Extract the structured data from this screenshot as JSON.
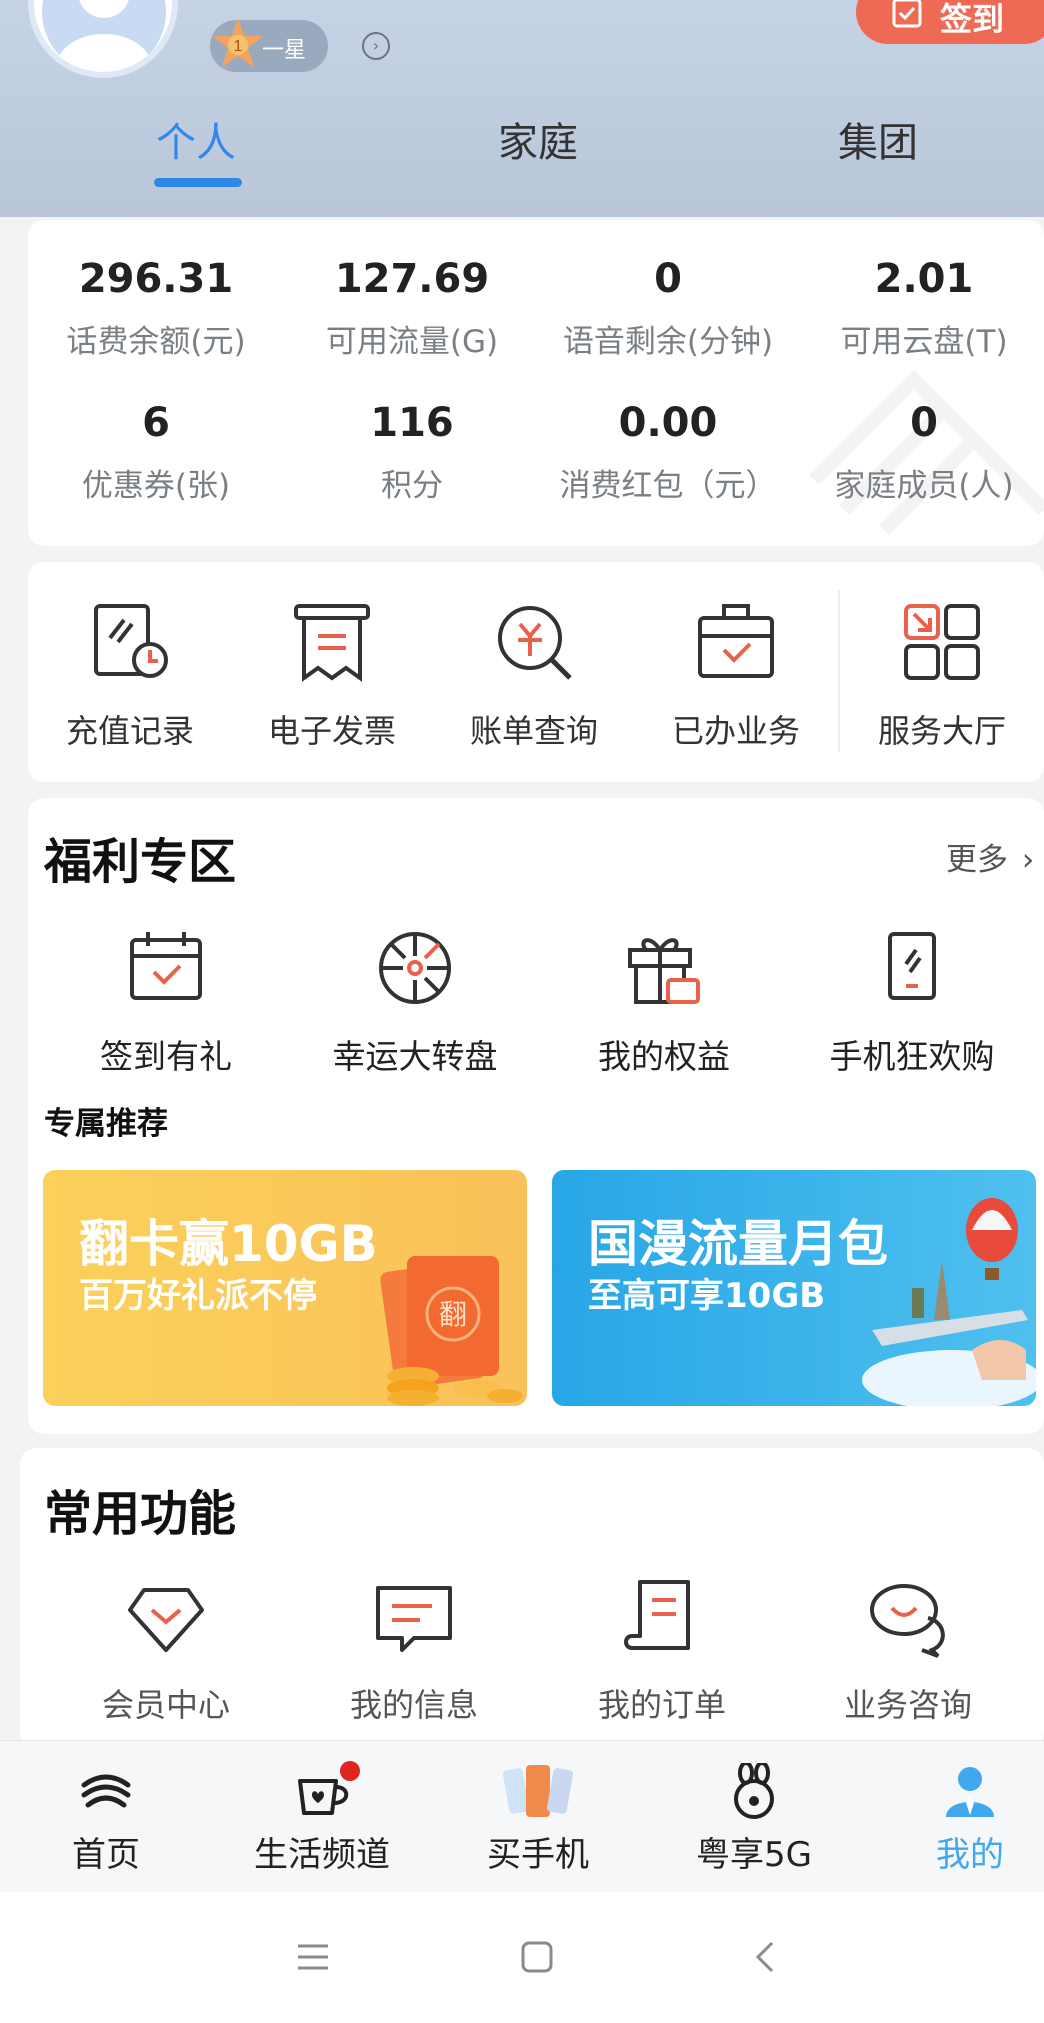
{
  "colors": {
    "accent_blue": "#2f88e8",
    "signin_orange": "#ef6a55",
    "icon_red": "#e9614a",
    "nav_active": "#41a7ee"
  },
  "header": {
    "level_badge": "1",
    "level_text": "一星",
    "signin_label": "签到",
    "tabs": [
      {
        "label": "个人",
        "active": true
      },
      {
        "label": "家庭",
        "active": false
      },
      {
        "label": "集团",
        "active": false
      }
    ]
  },
  "stats": [
    {
      "value": "296.31",
      "label": "话费余额(元)"
    },
    {
      "value": "127.69",
      "label": "可用流量(G)"
    },
    {
      "value": "0",
      "label": "语音剩余(分钟)"
    },
    {
      "value": "2.01",
      "label": "可用云盘(T)"
    },
    {
      "value": "6",
      "label": "优惠券(张)"
    },
    {
      "value": "116",
      "label": "积分"
    },
    {
      "value": "0.00",
      "label": "消费红包（元）"
    },
    {
      "value": "0",
      "label": "家庭成员(人)"
    }
  ],
  "quick_links": [
    {
      "label": "充值记录",
      "icon": "recharge-record-icon"
    },
    {
      "label": "电子发票",
      "icon": "invoice-icon"
    },
    {
      "label": "账单查询",
      "icon": "bill-search-icon"
    },
    {
      "label": "已办业务",
      "icon": "briefcase-icon"
    },
    {
      "label": "服务大厅",
      "icon": "service-grid-icon"
    }
  ],
  "welfare": {
    "title": "福利专区",
    "more": "更多",
    "items": [
      {
        "label": "签到有礼",
        "icon": "calendar-check-icon"
      },
      {
        "label": "幸运大转盘",
        "icon": "wheel-icon"
      },
      {
        "label": "我的权益",
        "icon": "gift-icon"
      },
      {
        "label": "手机狂欢购",
        "icon": "phone-icon"
      }
    ],
    "recommend_title": "专属推荐",
    "banners": [
      {
        "title": "翻卡赢10GB",
        "subtitle": "百万好礼派不停",
        "card_char": "翻"
      },
      {
        "title": "国漫流量月包",
        "subtitle": "至高可享10GB"
      }
    ]
  },
  "common": {
    "title": "常用功能",
    "items": [
      {
        "label": "会员中心",
        "icon": "diamond-icon"
      },
      {
        "label": "我的信息",
        "icon": "message-icon"
      },
      {
        "label": "我的订单",
        "icon": "order-icon"
      },
      {
        "label": "业务咨询",
        "icon": "chat-icon"
      }
    ]
  },
  "bottom_nav": [
    {
      "label": "首页",
      "icon": "china-mobile-logo-icon",
      "active": false
    },
    {
      "label": "生活频道",
      "icon": "coffee-cup-icon",
      "active": false
    },
    {
      "label": "买手机",
      "icon": "phones-icon",
      "active": false
    },
    {
      "label": "粤享5G",
      "icon": "rabbit-icon",
      "active": false
    },
    {
      "label": "我的",
      "icon": "user-icon",
      "active": true
    }
  ]
}
